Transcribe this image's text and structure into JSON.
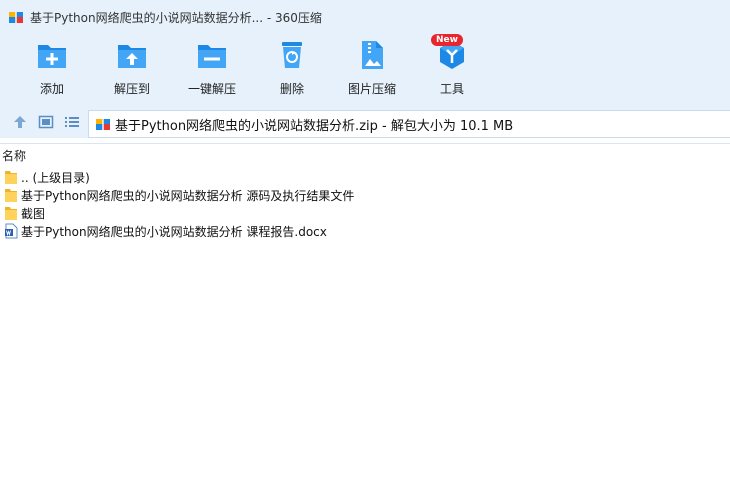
{
  "window": {
    "title": "基于Python网络爬虫的小说网站数据分析... - 360压缩"
  },
  "toolbar": {
    "items": [
      {
        "label": "添加",
        "icon": "add-icon"
      },
      {
        "label": "解压到",
        "icon": "extract-to-icon"
      },
      {
        "label": "一键解压",
        "icon": "one-click-extract-icon"
      },
      {
        "label": "删除",
        "icon": "delete-icon"
      },
      {
        "label": "图片压缩",
        "icon": "image-compress-icon"
      },
      {
        "label": "工具",
        "icon": "tools-icon",
        "badge": "New"
      }
    ]
  },
  "path": {
    "text": "基于Python网络爬虫的小说网站数据分析.zip - 解包大小为 10.1 MB"
  },
  "file_list": {
    "column_name": "名称",
    "rows": [
      {
        "name": ".. (上级目录)",
        "type": "folder"
      },
      {
        "name": "基于Python网络爬虫的小说网站数据分析 源码及执行结果文件",
        "type": "folder"
      },
      {
        "name": "截图",
        "type": "folder"
      },
      {
        "name": "基于Python网络爬虫的小说网站数据分析 课程报告.docx",
        "type": "docx"
      }
    ]
  },
  "colors": {
    "chrome": "#e6f1fb",
    "accent": "#1e88e5",
    "folder": "#ffd25c",
    "badge": "#e8262e"
  }
}
